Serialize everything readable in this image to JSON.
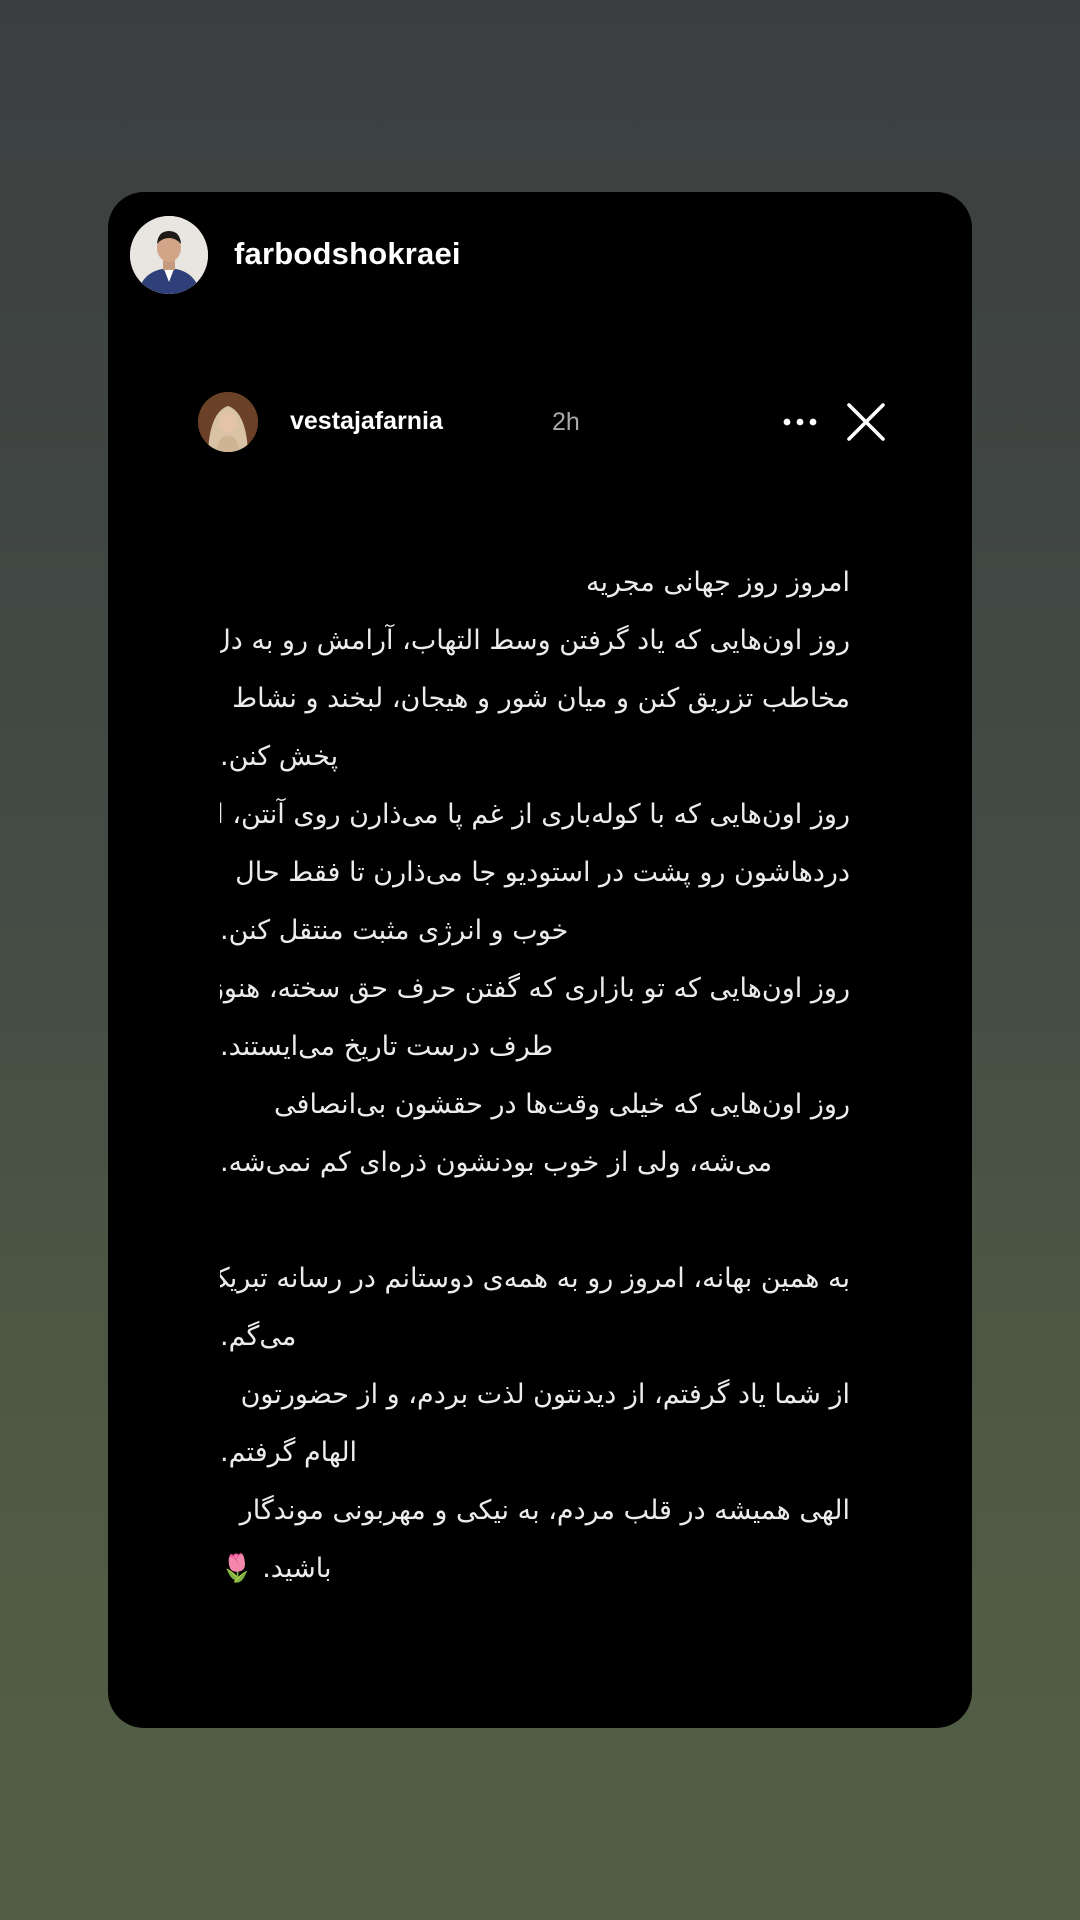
{
  "story": {
    "sharer_username": "farbodshokraei",
    "sharer_avatar_icon": "profile-photo-icon"
  },
  "post": {
    "username": "vestajafarnia",
    "time": "2h",
    "avatar_icon": "profile-photo-icon",
    "more_icon": "more-dots-icon",
    "close_icon": "close-icon",
    "lines": [
      "امروز روز جهانی مجریه",
      "روز اون‌هایی که یاد گرفتن وسط التهاب، آرامش رو به دل",
      "مخاطب تزریق کنن و میان شور و هیجان، لبخند و نشاط",
      "پخش کنن.",
      "روز اون‌هایی که با کوله‌باری از غم پا می‌ذارن روی آنتن، اما",
      "دردهاشون رو پشت در استودیو جا می‌ذارن تا فقط حال",
      "خوب و انرژی مثبت منتقل کنن.",
      "روز اون‌هایی که تو بازاری که گفتن حرف حق سخته، هنوز",
      "طرف درست تاریخ می‌ایستند.",
      "روز اون‌هایی که خیلی وقت‌ها در حقشون بی‌انصافی",
      "می‌شه، ولی از خوب بودنشون ذره‌ای کم نمی‌شه.",
      "",
      "به همین بهانه، امروز رو به همه‌ی دوستانم در رسانه تبریک",
      "می‌گم.",
      "از شما یاد گرفتم، از دیدنتون لذت بردم، و از حضورتون",
      "الهام گرفتم.",
      "الهی همیشه در قلب مردم، به نیکی و مهربونی موندگار",
      "باشید. 🌷"
    ]
  }
}
